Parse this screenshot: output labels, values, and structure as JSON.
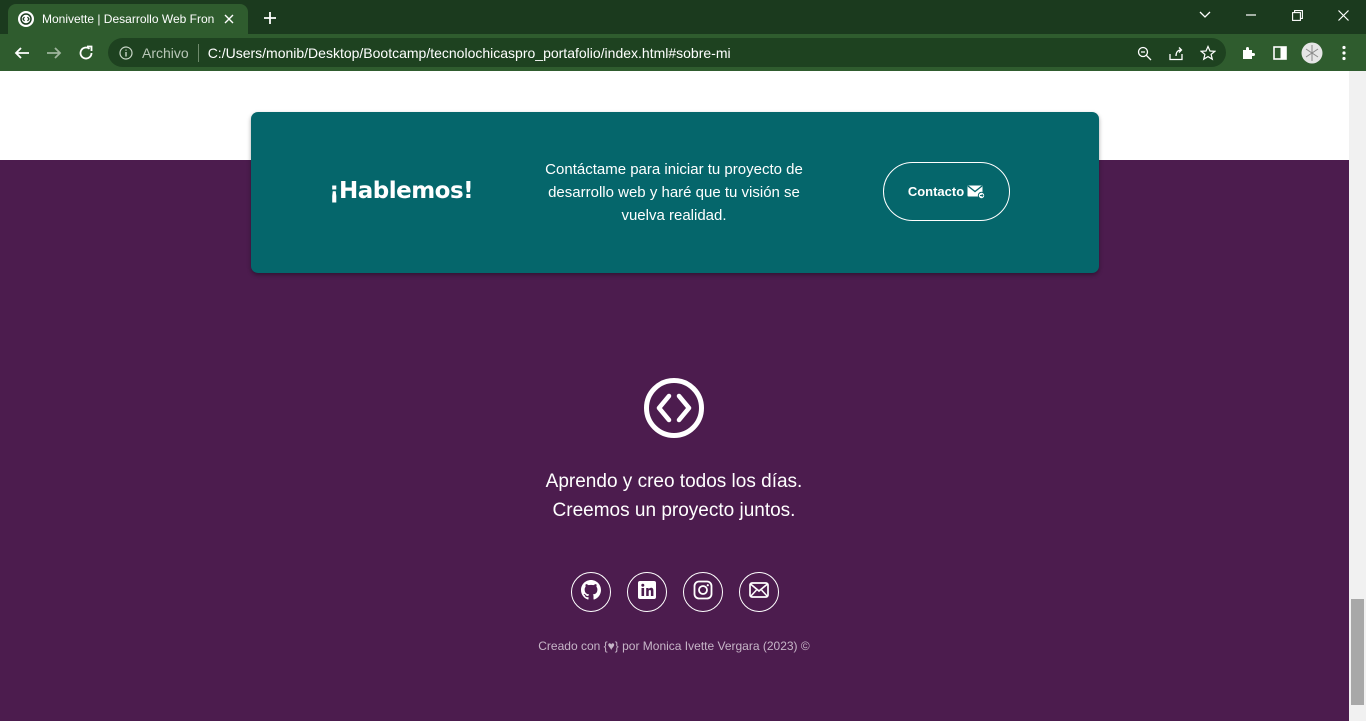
{
  "browser": {
    "tab_title": "Monivette | Desarrollo Web Front",
    "address_scheme": "Archivo",
    "address_url": "C:/Users/monib/Desktop/Bootcamp/tecnolochicaspro_portafolio/index.html#sobre-mi"
  },
  "cta": {
    "title": "¡Hablemos!",
    "text": "Contáctame para iniciar tu proyecto de desarrollo web y haré que tu visión se vuelva realidad.",
    "button_label": "Contacto"
  },
  "footer": {
    "tagline_line1": "Aprendo y creo todos los días.",
    "tagline_line2": "Creemos un proyecto juntos.",
    "socials": [
      "github-icon",
      "linkedin-icon",
      "instagram-icon",
      "mail-icon"
    ],
    "credits": "Creado con {♥} por Monica Ivette Vergara (2023) ©"
  },
  "colors": {
    "page_bg": "#4c1c4e",
    "cta_bg": "#05666b",
    "chrome_dark": "#1b3a1e",
    "chrome_light": "#2f5c2e"
  }
}
